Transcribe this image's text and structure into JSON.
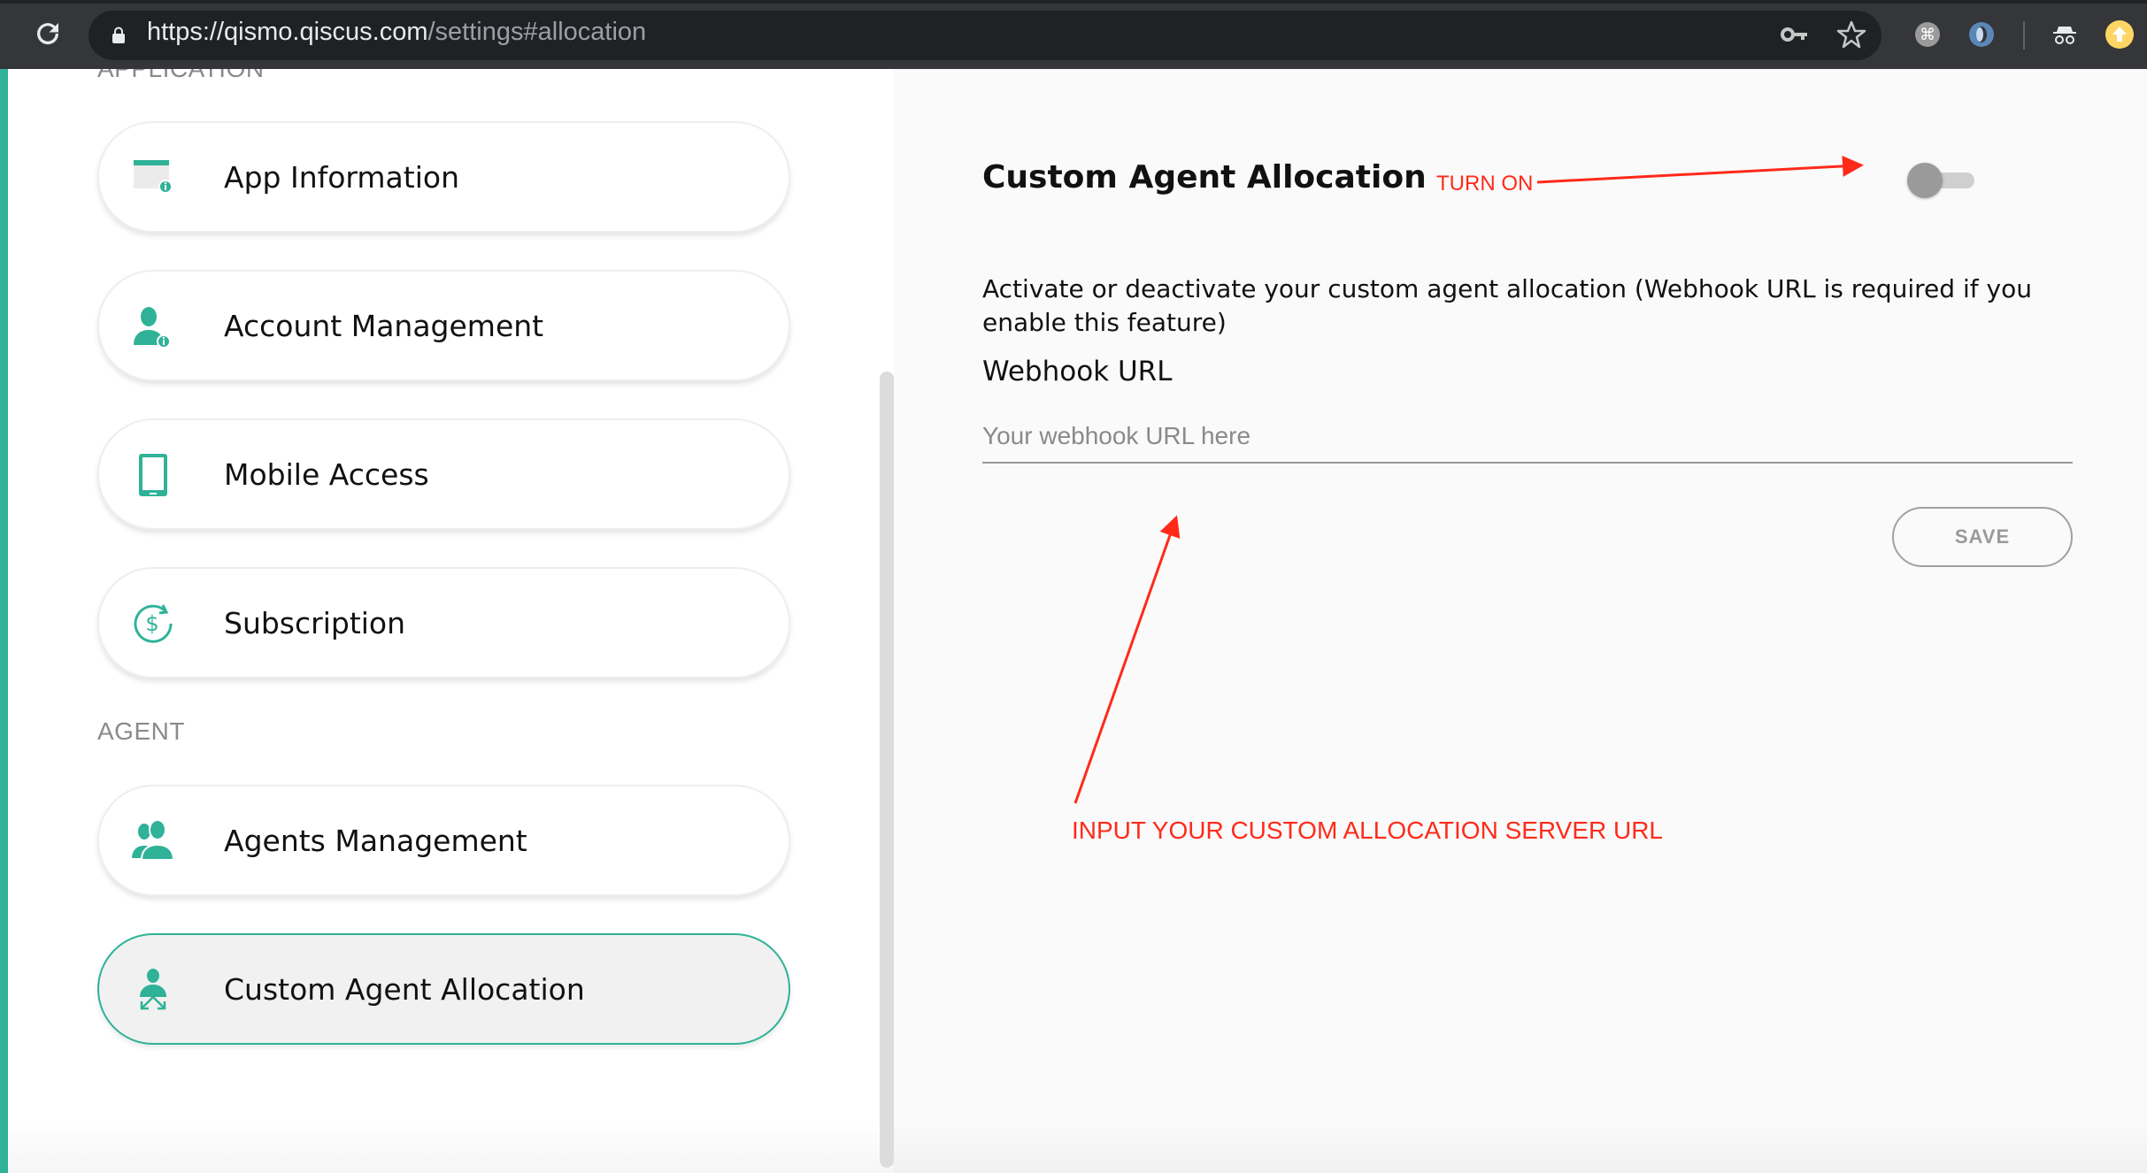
{
  "browser": {
    "url_host": "https://qismo.qiscus.com",
    "url_path": "/settings#allocation",
    "icons": [
      "reload-icon",
      "lock-icon",
      "key-icon",
      "star-icon",
      "command-extension-icon",
      "circle-extension-icon",
      "incognito-icon",
      "update-icon"
    ]
  },
  "colors": {
    "accent": "#2fb297",
    "annotation": "#ff2a1a",
    "toggle_off_thumb": "#9a9a9a",
    "toggle_off_track": "#cfcfcf"
  },
  "sidebar": {
    "sections": [
      {
        "label": "APPLICATION",
        "items": [
          {
            "label": "App Information",
            "icon": "app-info-icon",
            "active": false
          },
          {
            "label": "Account Management",
            "icon": "account-icon",
            "active": false
          },
          {
            "label": "Mobile Access",
            "icon": "mobile-icon",
            "active": false
          },
          {
            "label": "Subscription",
            "icon": "subscription-dollar-icon",
            "active": false
          }
        ]
      },
      {
        "label": "AGENT",
        "items": [
          {
            "label": "Agents Management",
            "icon": "agents-icon",
            "active": false
          },
          {
            "label": "Custom Agent Allocation",
            "icon": "agent-allocation-icon",
            "active": true
          }
        ]
      }
    ]
  },
  "panel": {
    "title": "Custom Agent Allocation",
    "toggle_on": false,
    "description": "Activate or deactivate your custom agent allocation (Webhook URL is required if you enable this feature)",
    "webhook_label": "Webhook URL",
    "webhook_value": "",
    "webhook_placeholder": "Your webhook URL here",
    "save_label": "SAVE"
  },
  "annotations": {
    "turn_on": "TURN ON",
    "input_hint": "INPUT YOUR CUSTOM ALLOCATION SERVER URL"
  }
}
